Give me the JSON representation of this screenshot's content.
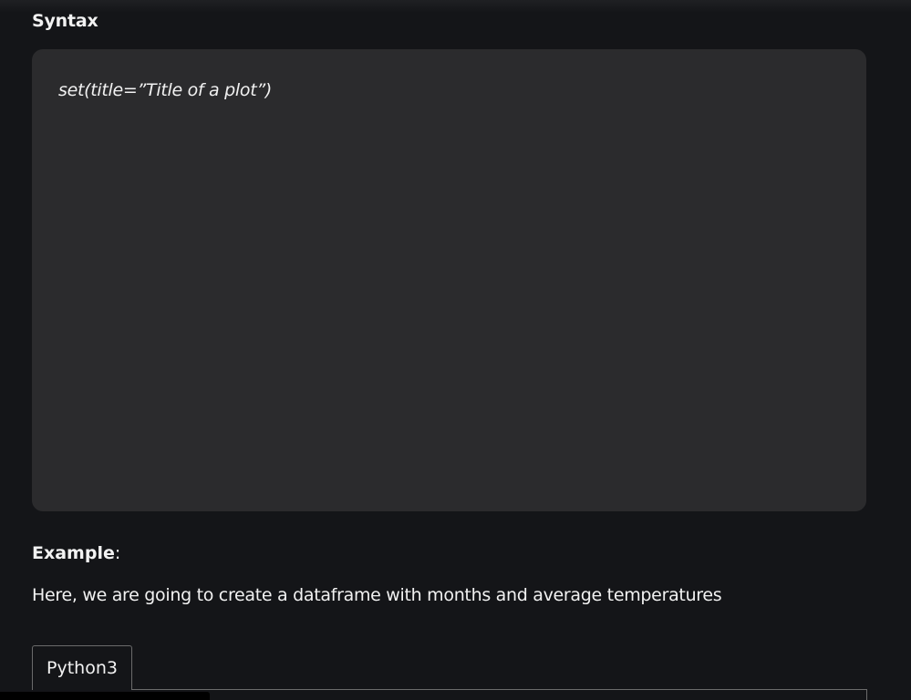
{
  "section": {
    "title": "Syntax"
  },
  "code_block": {
    "code": "set(title=”Title of a plot”)"
  },
  "example": {
    "heading": "Example",
    "heading_suffix": ":",
    "description": "Here, we are going to create a dataframe with months and average temperatures"
  },
  "tabs": [
    {
      "label": "Python3",
      "selected": true
    }
  ],
  "colors": {
    "page_background": "#141518",
    "code_background": "#2b2b2d",
    "text": "#f2f2f2",
    "tab_border": "#6b6b6b"
  }
}
